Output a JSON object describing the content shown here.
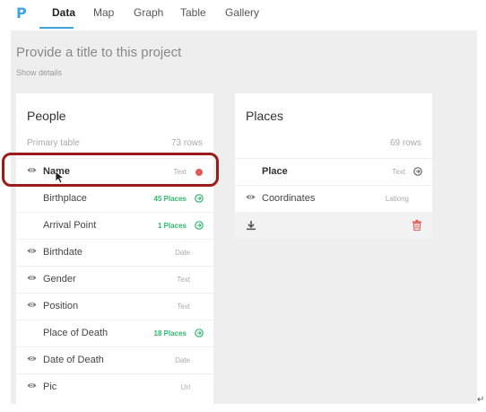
{
  "app": {
    "logo": "P"
  },
  "nav": {
    "tabs": [
      "Data",
      "Map",
      "Graph",
      "Table",
      "Gallery"
    ],
    "active": "Data"
  },
  "project": {
    "title": "Provide a title to this project",
    "show_details": "Show details"
  },
  "people": {
    "title": "People",
    "primary_label": "Primary table",
    "rows_count": "73 rows",
    "fields": [
      {
        "name": "Name",
        "type": "Text",
        "eye": true,
        "bold": true,
        "status": "dot"
      },
      {
        "name": "Birthplace",
        "type": "45 Places",
        "eye": false,
        "link": true
      },
      {
        "name": "Arrival Point",
        "type": "1 Places",
        "eye": false,
        "link": true
      },
      {
        "name": "Birthdate",
        "type": "Date",
        "eye": true
      },
      {
        "name": "Gender",
        "type": "Text",
        "eye": true
      },
      {
        "name": "Position",
        "type": "Text",
        "eye": true
      },
      {
        "name": "Place of Death",
        "type": "18 Places",
        "eye": false,
        "link": true
      },
      {
        "name": "Date of Death",
        "type": "Date",
        "eye": true
      },
      {
        "name": "Pic",
        "type": "Url",
        "eye": true
      }
    ]
  },
  "places": {
    "title": "Places",
    "rows_count": "69 rows",
    "fields": [
      {
        "name": "Place",
        "type": "Text",
        "eye": false,
        "bold": true,
        "status": "arrow"
      },
      {
        "name": "Coordinates",
        "type": "Latlong",
        "eye": true
      }
    ]
  },
  "colors": {
    "accent": "#3aa5dc",
    "link_green": "#2fb96e",
    "danger": "#e15a5a",
    "highlight_ring": "#9b1b1b"
  },
  "icons": {
    "eye": "eye-icon",
    "link": "arrow-circle-right-icon",
    "download": "download-icon",
    "trash": "trash-icon",
    "cursor": "mouse-pointer-icon"
  },
  "misc": {
    "return_glyph": "↵"
  }
}
